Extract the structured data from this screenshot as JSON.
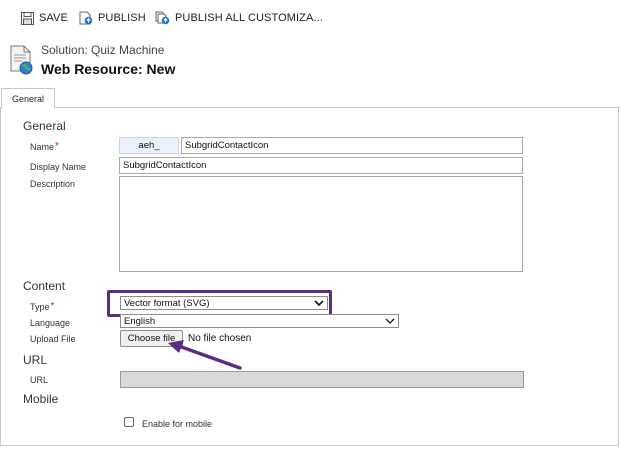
{
  "toolbar": {
    "save_label": "SAVE",
    "publish_label": "PUBLISH",
    "publish_all_label": "PUBLISH ALL CUSTOMIZA..."
  },
  "header": {
    "solution_line": "Solution: Quiz Machine",
    "title": "Web Resource: New"
  },
  "tabs": [
    {
      "label": "General"
    }
  ],
  "general": {
    "section_title": "General",
    "name_label": "Name",
    "name_prefix": "aeh_",
    "name_value": "SubgridContactIcon",
    "display_name_label": "Display Name",
    "display_name_value": "SubgridContactIcon",
    "description_label": "Description",
    "description_value": ""
  },
  "content": {
    "section_title": "Content",
    "type_label": "Type",
    "type_value": "Vector format (SVG)",
    "language_label": "Language",
    "language_value": "English",
    "upload_label": "Upload File",
    "choose_file_label": "Choose file",
    "no_file_text": "No file chosen"
  },
  "url": {
    "section_title": "URL",
    "url_label": "URL",
    "url_value": ""
  },
  "mobile": {
    "section_title": "Mobile",
    "enable_label": "Enable for mobile",
    "enabled": false
  },
  "required_marker": "*",
  "colors": {
    "highlight": "#5b2d82",
    "required": "#c8102e",
    "prefix_bg": "#eaf1fb"
  },
  "icons": [
    "save-icon",
    "publish-icon",
    "publish-all-icon",
    "web-resource-icon",
    "chevron-down-icon",
    "annotation-arrow"
  ]
}
